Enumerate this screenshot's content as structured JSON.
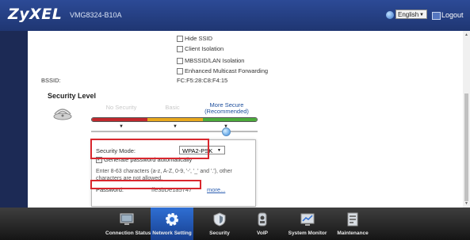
{
  "header": {
    "brand": "ZyXEL",
    "model": "VMG8324-B10A",
    "language_selected": "English",
    "logout_label": "Logout"
  },
  "options": [
    {
      "label": "Hide SSID",
      "checked": false
    },
    {
      "label": "Client Isolation",
      "checked": false
    },
    {
      "label": "MBSSID/LAN Isolation",
      "checked": false
    },
    {
      "label": "Enhanced Multicast Forwarding",
      "checked": false
    }
  ],
  "bssid": {
    "label": "BSSID:",
    "value": "FC:F5:28:C8:F4:15"
  },
  "security": {
    "title": "Security Level",
    "levels": [
      "No Security",
      "Basic",
      "More Secure (Recommended)"
    ],
    "selected_level": "More Secure (Recommended)",
    "mode_label": "Security Mode:",
    "mode_value": "WPA2-PSK",
    "generate_label": "Generate password automatically",
    "generate_checked": true,
    "hint": "Enter 8-63 characters (a-z, A-Z, 0-9, '-', '_' and '.'), other characters are not allowed.",
    "password_label": "Password:",
    "password_value": "ffe3bDe1a5747",
    "more_label": "more..."
  },
  "colors": {
    "no_security": "#c0282d",
    "basic": "#e8a81e",
    "secure": "#4bab3a",
    "accent": "#2f6fd4"
  },
  "nav": [
    {
      "label": "Connection Status",
      "icon": "monitor-status-icon",
      "active": false
    },
    {
      "label": "Network Setting",
      "icon": "gear-icon",
      "active": true
    },
    {
      "label": "Security",
      "icon": "shield-icon",
      "active": false
    },
    {
      "label": "VoIP",
      "icon": "phone-icon",
      "active": false
    },
    {
      "label": "System Monitor",
      "icon": "chart-monitor-icon",
      "active": false
    },
    {
      "label": "Maintenance",
      "icon": "toolbox-icon",
      "active": false
    }
  ]
}
